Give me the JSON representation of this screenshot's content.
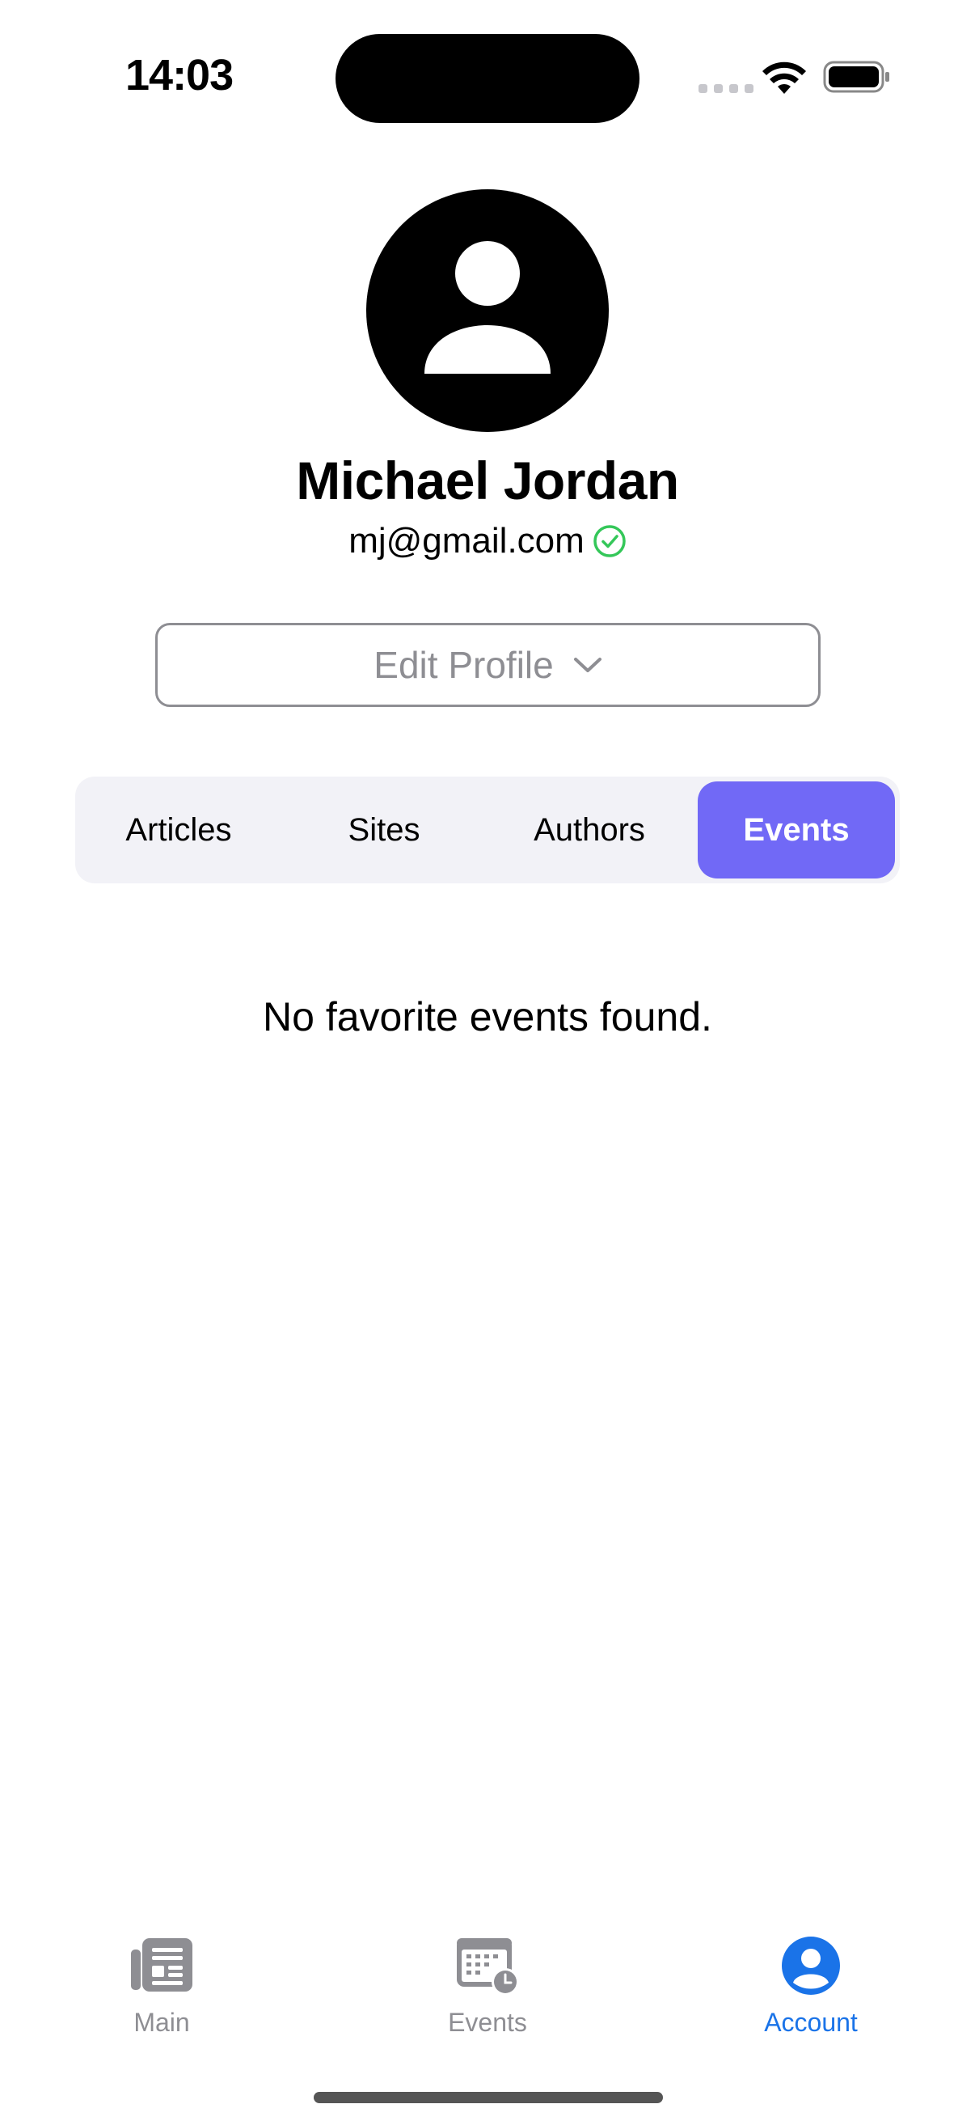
{
  "status_bar": {
    "time": "14:03"
  },
  "profile": {
    "name": "Michael Jordan",
    "email": "mj@gmail.com",
    "verified": true
  },
  "edit_profile": {
    "label": "Edit Profile"
  },
  "segments": {
    "items": [
      {
        "label": "Articles"
      },
      {
        "label": "Sites"
      },
      {
        "label": "Authors"
      },
      {
        "label": "Events"
      }
    ],
    "selected": "Events"
  },
  "content": {
    "empty_message": "No favorite events found."
  },
  "tab_bar": {
    "items": [
      {
        "label": "Main",
        "icon": "newspaper-icon"
      },
      {
        "label": "Events",
        "icon": "calendar-clock-icon"
      },
      {
        "label": "Account",
        "icon": "person-circle-icon"
      }
    ],
    "selected": "Account"
  },
  "colors": {
    "accent": "#7169f6",
    "tab_active": "#1a73e8",
    "inactive": "#8e8e93",
    "verified": "#34c759"
  }
}
